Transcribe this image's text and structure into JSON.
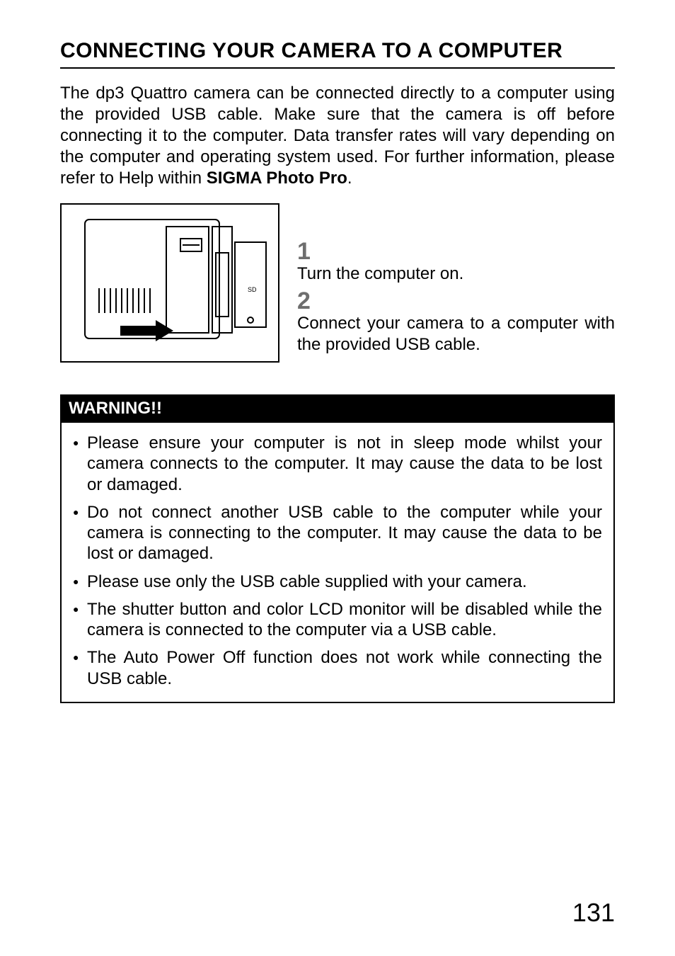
{
  "title": "CONNECTING YOUR CAMERA TO A COMPUTER",
  "intro_part1": "The dp3 Quattro camera can be connected directly to a computer using the provided USB cable. Make sure that the camera is off before connecting it to the computer. Data transfer rates will vary depending on the computer and operating system used. For further information, please refer to Help within ",
  "intro_bold": "SIGMA Photo Pro",
  "intro_part2": ".",
  "figure_sd_label": "SD",
  "steps": {
    "n1": "1",
    "t1": "Turn the computer on.",
    "n2": "2",
    "t2": "Connect your camera to a computer with the provided USB cable."
  },
  "warning": {
    "header": "WARNING!!",
    "items": [
      "Please ensure your computer is not in sleep mode whilst your camera connects to the computer. It may cause the data to be lost or damaged.",
      "Do not connect another USB cable to the computer while your camera is connecting to the computer. It may cause the data to be lost or damaged.",
      "Please use only the USB cable supplied with your camera.",
      "The shutter button and color LCD monitor will be disabled while the camera is connected to the computer via a USB cable.",
      "The Auto Power Off function does not work while connecting the USB cable."
    ]
  },
  "page_number": "131"
}
